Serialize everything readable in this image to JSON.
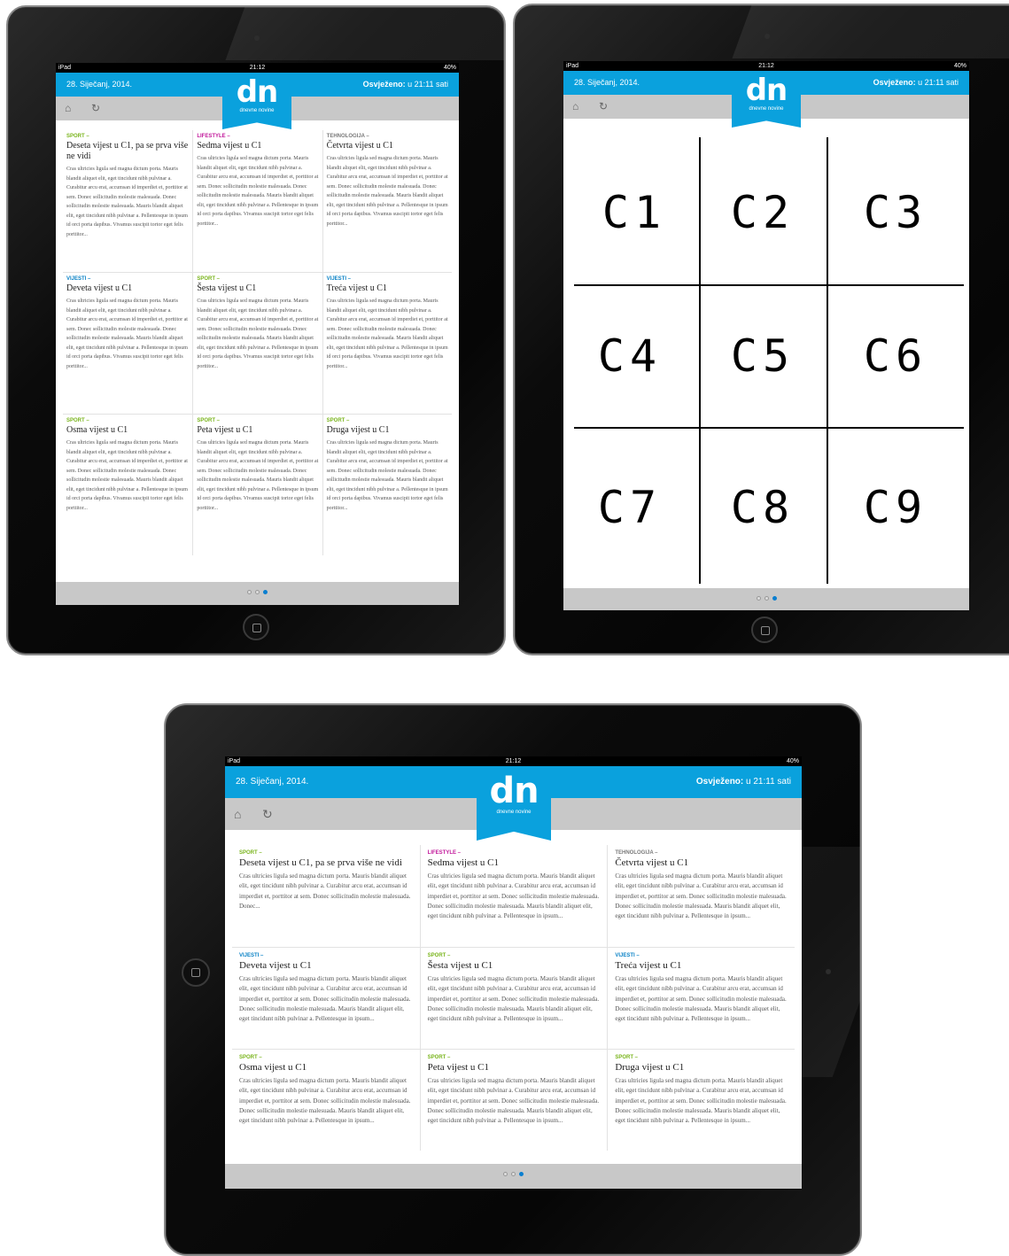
{
  "colors": {
    "accent": "#0aa1dd",
    "sport": "#7ab51d",
    "lifestyle": "#c2189b",
    "tehnologija": "#7a7a7a",
    "vijesti": "#0a82c6"
  },
  "status": {
    "device": "iPad",
    "time": "21:12",
    "battery": "40%"
  },
  "header": {
    "date": "28. Siječanj, 2014.",
    "refresh_label": "Osvježeno:",
    "refresh_value": "u 21:11 sati",
    "home_icon": "home-icon",
    "sync_icon": "refresh-icon"
  },
  "logo": {
    "text": "dn",
    "subtitle": "dnevne novine"
  },
  "pager": {
    "pages": 3,
    "active": 3
  },
  "articles": [
    {
      "category": "SPORT –",
      "cat_key": "sport",
      "title": "Deseta vijest u C1, pa se prva više ne vidi"
    },
    {
      "category": "LIFESTYLE –",
      "cat_key": "lifestyle",
      "title": "Sedma vijest u C1"
    },
    {
      "category": "TEHNOLOGIJA –",
      "cat_key": "tehnologija",
      "title": "Četvrta vijest u C1"
    },
    {
      "category": "VIJESTI –",
      "cat_key": "vijesti",
      "title": "Deveta vijest u C1"
    },
    {
      "category": "SPORT –",
      "cat_key": "sport",
      "title": "Šesta vijest u C1"
    },
    {
      "category": "VIJESTI –",
      "cat_key": "vijesti",
      "title": "Treća vijest u C1"
    },
    {
      "category": "SPORT –",
      "cat_key": "sport",
      "title": "Osma vijest u C1"
    },
    {
      "category": "SPORT –",
      "cat_key": "sport",
      "title": "Peta vijest u C1"
    },
    {
      "category": "SPORT –",
      "cat_key": "sport",
      "title": "Druga vijest u C1"
    }
  ],
  "body_portrait": "Cras ultricies ligula sed magna dictum porta. Mauris blandit aliquet elit, eget tincidunt nibh pulvinar a. Curabitur arcu erat, accumsan id imperdiet et, porttitor at sem. Donec sollicitudin molestie malesuada. Donec sollicitudin molestie malesuada. Mauris blandit aliquet elit, eget tincidunt nibh pulvinar a. Pellentesque in ipsum id orci porta dapibus. Vivamus suscipit tortor eget felis porttitor...",
  "body_landscape_short": "Cras ultricies ligula sed magna dictum porta. Mauris blandit aliquet elit, eget tincidunt nibh pulvinar a. Curabitur arcu erat, accumsan id imperdiet et, porttitor at sem. Donec sollicitudin molestie malesuada. Donec...",
  "body_landscape": "Cras ultricies ligula sed magna dictum porta. Mauris blandit aliquet elit, eget tincidunt nibh pulvinar a. Curabitur arcu erat, accumsan id imperdiet et, porttitor at sem. Donec sollicitudin molestie malesuada. Donec sollicitudin molestie malesuada. Mauris blandit aliquet elit, eget tincidunt nibh pulvinar a. Pellentesque in ipsum...",
  "wireframe_cells": [
    "C1",
    "C2",
    "C3",
    "C4",
    "C5",
    "C6",
    "C7",
    "C8",
    "C9"
  ]
}
